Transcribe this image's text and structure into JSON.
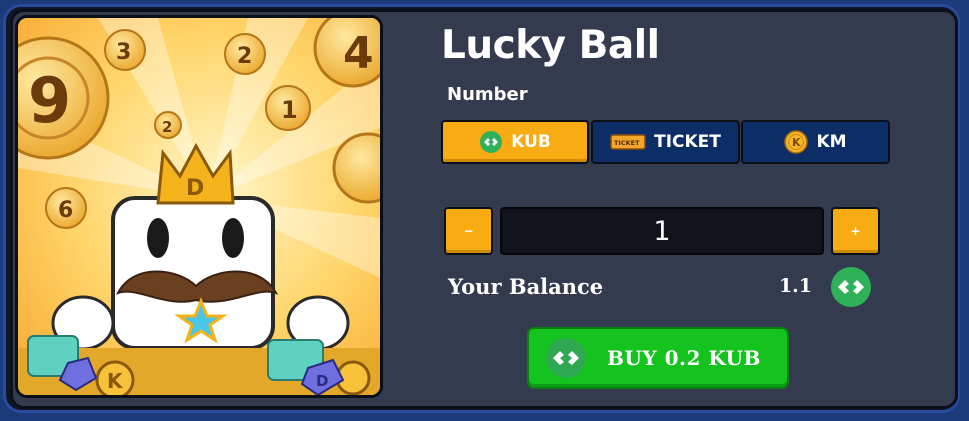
{
  "game": {
    "title": "Lucky Ball",
    "artwork": {
      "ball_numbers": [
        "3",
        "2",
        "4",
        "9",
        "2",
        "1",
        "6"
      ],
      "coin_letter": "K",
      "crown_letter": "D",
      "gem_letter": "D"
    }
  },
  "section": {
    "label": "Number"
  },
  "currency_tabs": [
    {
      "label": "KUB",
      "icon": "kub-token-icon",
      "active": true
    },
    {
      "label": "TICKET",
      "icon": "ticket-icon",
      "ticket_text": "TICKET",
      "active": false
    },
    {
      "label": "KM",
      "icon": "km-coin-icon",
      "coin_letter": "K",
      "active": false
    }
  ],
  "quantity": {
    "value": "1",
    "decrement_label": "−",
    "increment_label": "+"
  },
  "balance": {
    "label": "Your Balance",
    "value": "1.1",
    "icon": "kub-token-icon"
  },
  "buy_button": {
    "label": "BUY 0.2 KUB",
    "icon": "kub-token-icon"
  },
  "colors": {
    "accent_orange": "#f6ac12",
    "tab_inactive": "#0c2d66",
    "buy_green": "#14c31d",
    "panel_bg": "#343b4e",
    "kub_token": "#2fb15a"
  }
}
